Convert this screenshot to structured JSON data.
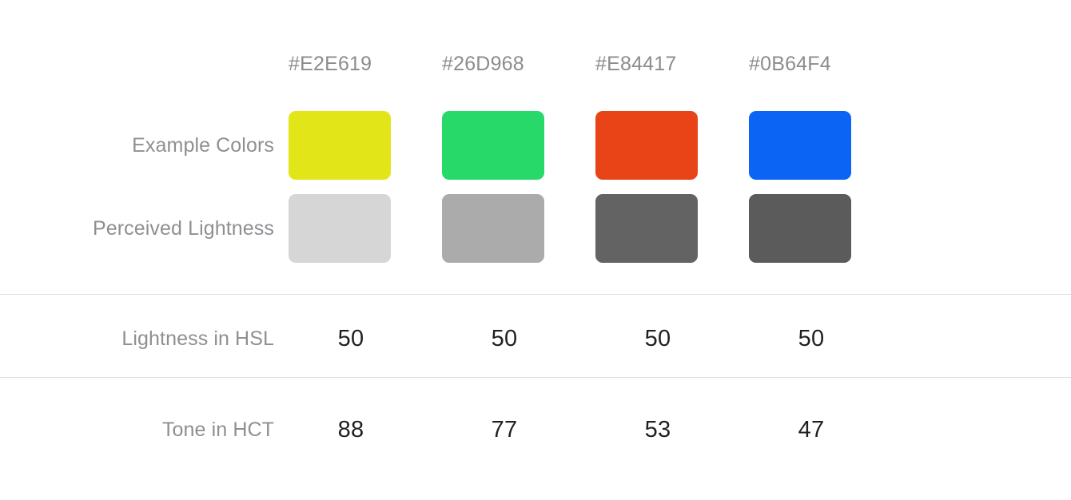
{
  "columns": [
    {
      "hex_label": "#E2E619",
      "example_color": "#E2E619",
      "perceived_color": "#D6D6D6",
      "hsl_lightness": "50",
      "hct_tone": "88"
    },
    {
      "hex_label": "#26D968",
      "example_color": "#26D968",
      "perceived_color": "#ABABAB",
      "hsl_lightness": "50",
      "hct_tone": "77"
    },
    {
      "hex_label": "#E84417",
      "example_color": "#E84417",
      "perceived_color": "#636363",
      "hsl_lightness": "50",
      "hct_tone": "53"
    },
    {
      "hex_label": "#0B64F4",
      "example_color": "#0B64F4",
      "perceived_color": "#5B5B5B",
      "hsl_lightness": "50",
      "hct_tone": "47"
    }
  ],
  "rows": {
    "example_colors_label": "Example Colors",
    "perceived_lightness_label": "Perceived Lightness",
    "lightness_hsl_label": "Lightness in HSL",
    "tone_hct_label": "Tone in HCT"
  },
  "colors": {
    "background": "#FFFFFF",
    "label_text": "#8D8F92",
    "header_text": "#8A8C8E",
    "value_text": "#1F2023",
    "divider": "#DCDEDF"
  }
}
